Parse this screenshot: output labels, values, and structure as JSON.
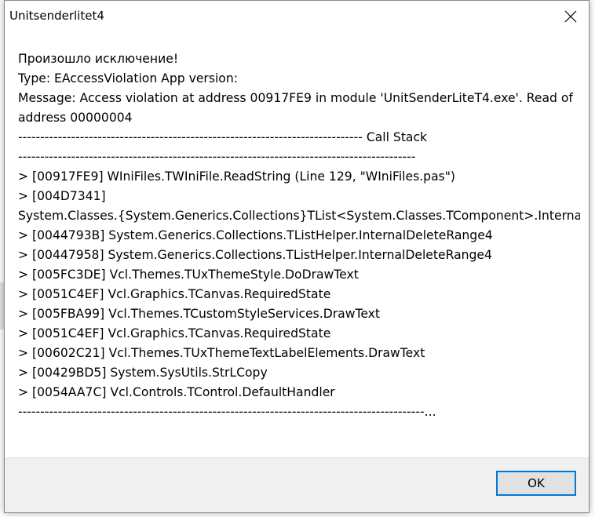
{
  "window": {
    "title": "Unitsenderlitet4"
  },
  "content": {
    "heading": "Произошло исключение!",
    "type_line": "Type: EAccessViolation App version:",
    "message_line": "Message: Access violation at address 00917FE9 in module 'UnitSenderLiteT4.exe'. Read of address 00000004",
    "separator_callstack": "------------------------------------------------------------------------------ Call Stack",
    "separator_1": "------------------------------------------------------------------------------------------",
    "stack": [
      "> [00917FE9] WIniFiles.TWIniFile.ReadString (Line 129, \"WIniFiles.pas\")",
      "> [004D7341]",
      "System.Classes.{System.Generics.Collections}TList<System.Classes.TComponent>.Internal...",
      "> [0044793B] System.Generics.Collections.TListHelper.InternalDeleteRange4",
      "> [00447958] System.Generics.Collections.TListHelper.InternalDeleteRange4",
      "> [005FC3DE] Vcl.Themes.TUxThemeStyle.DoDrawText",
      "> [0051C4EF] Vcl.Graphics.TCanvas.RequiredState",
      "> [005FBA99] Vcl.Themes.TCustomStyleServices.DrawText",
      "> [0051C4EF] Vcl.Graphics.TCanvas.RequiredState",
      "> [00602C21] Vcl.Themes.TUxThemeTextLabelElements.DrawText",
      "> [00429BD5] System.SysUtils.StrLCopy",
      "> [0054AA7C] Vcl.Controls.TControl.DefaultHandler"
    ],
    "separator_end": "--------------------------------------------------------------------------------------------..."
  },
  "footer": {
    "ok_label": "OK"
  },
  "icons": {
    "close": "close-icon"
  }
}
